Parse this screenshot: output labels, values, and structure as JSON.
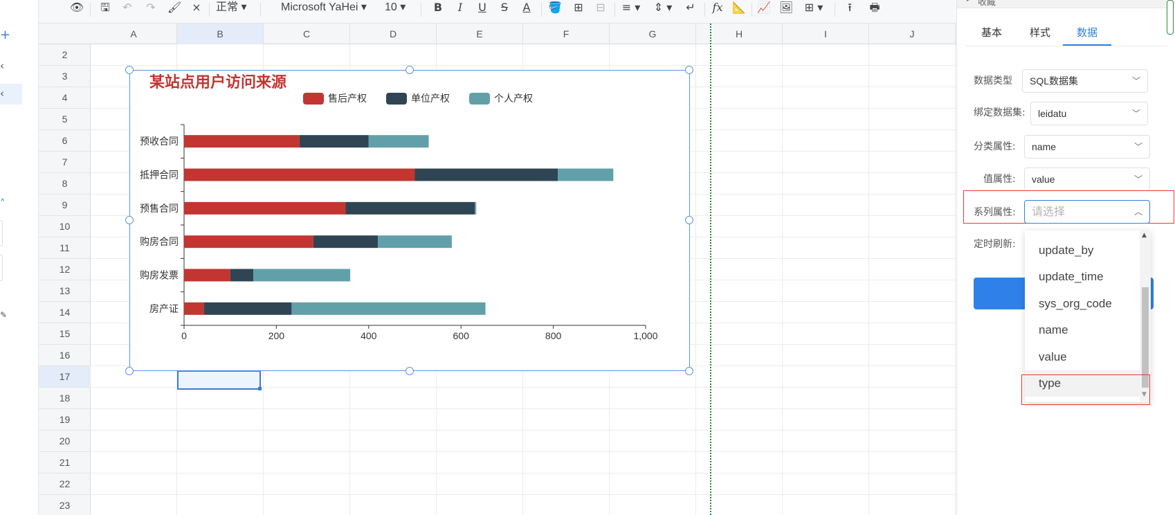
{
  "toolbar": {
    "font_style": "正常",
    "font_family": "Microsoft YaHei",
    "font_size": "10",
    "bold": "B",
    "italic": "I",
    "underline": "U",
    "strike": "S",
    "font_color": "A",
    "formula": "fx"
  },
  "sheet": {
    "columns": [
      "A",
      "B",
      "C",
      "D",
      "E",
      "F",
      "G",
      "H",
      "I",
      "J"
    ],
    "rows": [
      "2",
      "3",
      "4",
      "5",
      "6",
      "7",
      "8",
      "9",
      "10",
      "11",
      "12",
      "13",
      "14",
      "15",
      "16",
      "17",
      "18",
      "19",
      "20",
      "21",
      "22",
      "23"
    ],
    "active_column": "B",
    "active_row": "17"
  },
  "chart_data": {
    "type": "bar",
    "orientation": "horizontal",
    "stacked": true,
    "title": "某站点用户访问来源",
    "categories": [
      "预收合同",
      "抵押合同",
      "预售合同",
      "购房合同",
      "购房发票",
      "房产证"
    ],
    "series": [
      {
        "name": "售后产权",
        "color": "#c23531",
        "values": [
          250,
          500,
          350,
          280,
          100,
          43
        ]
      },
      {
        "name": "单位产权",
        "color": "#2f4554",
        "values": [
          150,
          310,
          280,
          140,
          50,
          190
        ]
      },
      {
        "name": "个人产权",
        "color": "#61a0a8",
        "values": [
          130,
          120,
          3,
          160,
          210,
          420
        ]
      }
    ],
    "x_ticks": [
      "0",
      "200",
      "400",
      "600",
      "800",
      "1,000"
    ],
    "xlim": [
      0,
      1000
    ],
    "legend_position": "top",
    "grid": false
  },
  "panel": {
    "tabs": [
      {
        "label": "基本"
      },
      {
        "label": "样式"
      },
      {
        "label": "数据"
      }
    ],
    "active_tab": "数据",
    "fields": {
      "data_type": {
        "label": "数据类型",
        "value": "SQL数据集"
      },
      "dataset": {
        "label": "绑定数据集:",
        "value": "leidatu"
      },
      "category": {
        "label": "分类属性:",
        "value": "name"
      },
      "value_attr": {
        "label": "值属性:",
        "value": "value"
      },
      "series_attr": {
        "label": "系列属性:",
        "placeholder": "请选择"
      },
      "refresh": {
        "label": "定时刷新:"
      }
    },
    "dropdown_options": [
      "update_by",
      "update_time",
      "sys_org_code",
      "name",
      "value",
      "type"
    ],
    "hovered_option": "type"
  },
  "colors": {
    "accent": "#2f7fe0",
    "highlight_box": "#e53935",
    "guide_line": "#1e8a2e"
  }
}
